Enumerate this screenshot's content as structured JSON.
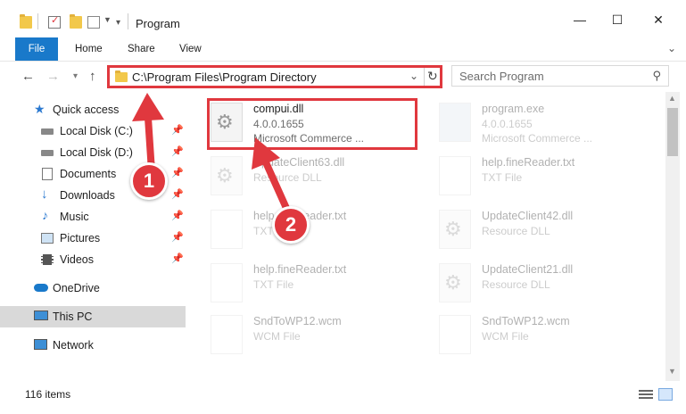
{
  "window": {
    "title": "Program",
    "minimize_glyph": "—",
    "maximize_glyph": "☐",
    "close_glyph": "✕"
  },
  "ribbon": {
    "tabs": [
      "File",
      "Home",
      "Share",
      "View"
    ]
  },
  "address": {
    "path": "C:\\Program Files\\Program Directory",
    "search_placeholder": "Search Program"
  },
  "nav": {
    "items": [
      {
        "label": "Quick access",
        "icon": "star-icon",
        "pinned": false
      },
      {
        "label": "Local Disk (C:)",
        "icon": "drive-icon",
        "pinned": true
      },
      {
        "label": "Local Disk (D:)",
        "icon": "drive-icon",
        "pinned": true
      },
      {
        "label": "Documents",
        "icon": "documents-icon",
        "pinned": true
      },
      {
        "label": "Downloads",
        "icon": "download-icon",
        "pinned": true
      },
      {
        "label": "Music",
        "icon": "music-icon",
        "pinned": true
      },
      {
        "label": "Pictures",
        "icon": "pictures-icon",
        "pinned": true
      },
      {
        "label": "Videos",
        "icon": "videos-icon",
        "pinned": true
      },
      {
        "label": "OneDrive",
        "icon": "cloud-icon",
        "pinned": false
      },
      {
        "label": "This PC",
        "icon": "computer-icon",
        "pinned": false
      },
      {
        "label": "Network",
        "icon": "network-icon",
        "pinned": false
      }
    ],
    "pin_glyph": "📌"
  },
  "files": [
    {
      "name": "compui.dll",
      "line1": "4.0.0.1655",
      "line2": "Microsoft Commerce ..."
    },
    {
      "name": "program.exe",
      "line1": "4.0.0.1655",
      "line2": "Microsoft Commerce ..."
    },
    {
      "name": "UpdateClient63.dll",
      "line1": "Resource DLL",
      "line2": ""
    },
    {
      "name": "help.fineReader.txt",
      "line1": "TXT File",
      "line2": ""
    },
    {
      "name": "help.fineReader.txt",
      "line1": "TXT File",
      "line2": ""
    },
    {
      "name": "UpdateClient42.dll",
      "line1": "Resource DLL",
      "line2": ""
    },
    {
      "name": "help.fineReader.txt",
      "line1": "TXT File",
      "line2": ""
    },
    {
      "name": "UpdateClient21.dll",
      "line1": "Resource DLL",
      "line2": ""
    },
    {
      "name": "SndToWP12.wcm",
      "line1": "WCM File",
      "line2": ""
    },
    {
      "name": "SndToWP12.wcm",
      "line1": "WCM File",
      "line2": ""
    }
  ],
  "status": {
    "item_count": "116 items"
  },
  "callouts": [
    "1",
    "2"
  ],
  "colors": {
    "accent": "#1979ca",
    "highlight": "#e0383e",
    "folder": "#f2c84b"
  }
}
